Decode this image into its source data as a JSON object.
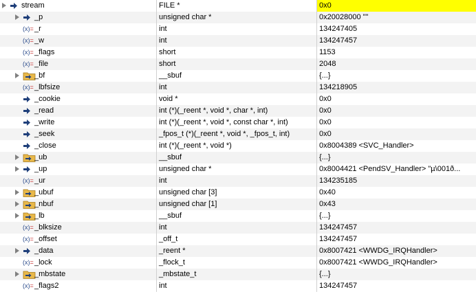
{
  "rows": [
    {
      "name": "stream",
      "type": "FILE *",
      "value": "0x0",
      "icon": "pointer-icon",
      "expandable": true,
      "level": 0
    },
    {
      "name": "_p",
      "type": "unsigned char *",
      "value": "0x20028000 \"\"",
      "icon": "pointer-icon",
      "expandable": true,
      "level": 1
    },
    {
      "name": "_r",
      "type": "int",
      "value": "134247405",
      "icon": "variable-icon",
      "expandable": false,
      "level": 1
    },
    {
      "name": "_w",
      "type": "int",
      "value": "134247457",
      "icon": "variable-icon",
      "expandable": false,
      "level": 1
    },
    {
      "name": "_flags",
      "type": "short",
      "value": "1153",
      "icon": "variable-icon",
      "expandable": false,
      "level": 1
    },
    {
      "name": "_file",
      "type": "short",
      "value": "2048",
      "icon": "variable-icon",
      "expandable": false,
      "level": 1
    },
    {
      "name": "_bf",
      "type": "__sbuf",
      "value": "{...}",
      "icon": "struct-icon",
      "expandable": true,
      "level": 1
    },
    {
      "name": "_lbfsize",
      "type": "int",
      "value": "134218905",
      "icon": "variable-icon",
      "expandable": false,
      "level": 1
    },
    {
      "name": "_cookie",
      "type": "void *",
      "value": "0x0",
      "icon": "pointer-icon",
      "expandable": false,
      "level": 1
    },
    {
      "name": "_read",
      "type": "int (*)(_reent *, void *, char *, int)",
      "value": "0x0",
      "icon": "pointer-icon",
      "expandable": false,
      "level": 1
    },
    {
      "name": "_write",
      "type": "int (*)(_reent *, void *, const char *, int)",
      "value": "0x0",
      "icon": "pointer-icon",
      "expandable": false,
      "level": 1
    },
    {
      "name": "_seek",
      "type": "_fpos_t (*)(_reent *, void *, _fpos_t, int)",
      "value": "0x0",
      "icon": "pointer-icon",
      "expandable": false,
      "level": 1
    },
    {
      "name": "_close",
      "type": "int (*)(_reent *, void *)",
      "value": "0x8004389 <SVC_Handler>",
      "icon": "pointer-icon",
      "expandable": false,
      "level": 1
    },
    {
      "name": "_ub",
      "type": "__sbuf",
      "value": "{...}",
      "icon": "struct-icon",
      "expandable": true,
      "level": 1
    },
    {
      "name": "_up",
      "type": "unsigned char *",
      "value": "0x8004421 <PendSV_Handler> \"µ\\001ð...",
      "icon": "pointer-icon",
      "expandable": true,
      "level": 1
    },
    {
      "name": "_ur",
      "type": "int",
      "value": "134235185",
      "icon": "variable-icon",
      "expandable": false,
      "level": 1
    },
    {
      "name": "_ubuf",
      "type": "unsigned char [3]",
      "value": "0x40",
      "icon": "struct-icon",
      "expandable": true,
      "level": 1
    },
    {
      "name": "_nbuf",
      "type": "unsigned char [1]",
      "value": "0x43",
      "icon": "struct-icon",
      "expandable": true,
      "level": 1
    },
    {
      "name": "_lb",
      "type": "__sbuf",
      "value": "{...}",
      "icon": "struct-icon",
      "expandable": true,
      "level": 1
    },
    {
      "name": "_blksize",
      "type": "int",
      "value": "134247457",
      "icon": "variable-icon",
      "expandable": false,
      "level": 1
    },
    {
      "name": "_offset",
      "type": "_off_t",
      "value": "134247457",
      "icon": "variable-icon",
      "expandable": false,
      "level": 1
    },
    {
      "name": "_data",
      "type": "_reent *",
      "value": "0x8007421 <WWDG_IRQHandler>",
      "icon": "pointer-icon",
      "expandable": true,
      "level": 1
    },
    {
      "name": "_lock",
      "type": "_flock_t",
      "value": "0x8007421 <WWDG_IRQHandler>",
      "icon": "variable-icon",
      "expandable": false,
      "level": 1
    },
    {
      "name": "_mbstate",
      "type": "_mbstate_t",
      "value": "{...}",
      "icon": "struct-icon",
      "expandable": true,
      "level": 1
    },
    {
      "name": "_flags2",
      "type": "int",
      "value": "134247457",
      "icon": "variable-icon",
      "expandable": false,
      "level": 1
    }
  ],
  "highlight_row": 0,
  "colors": {
    "highlight": "#ffff00",
    "pointer": "#1f3f7a",
    "folder": "#e8b84a",
    "grid": "#d0d0d0",
    "zebra": "#f3f3f3"
  }
}
